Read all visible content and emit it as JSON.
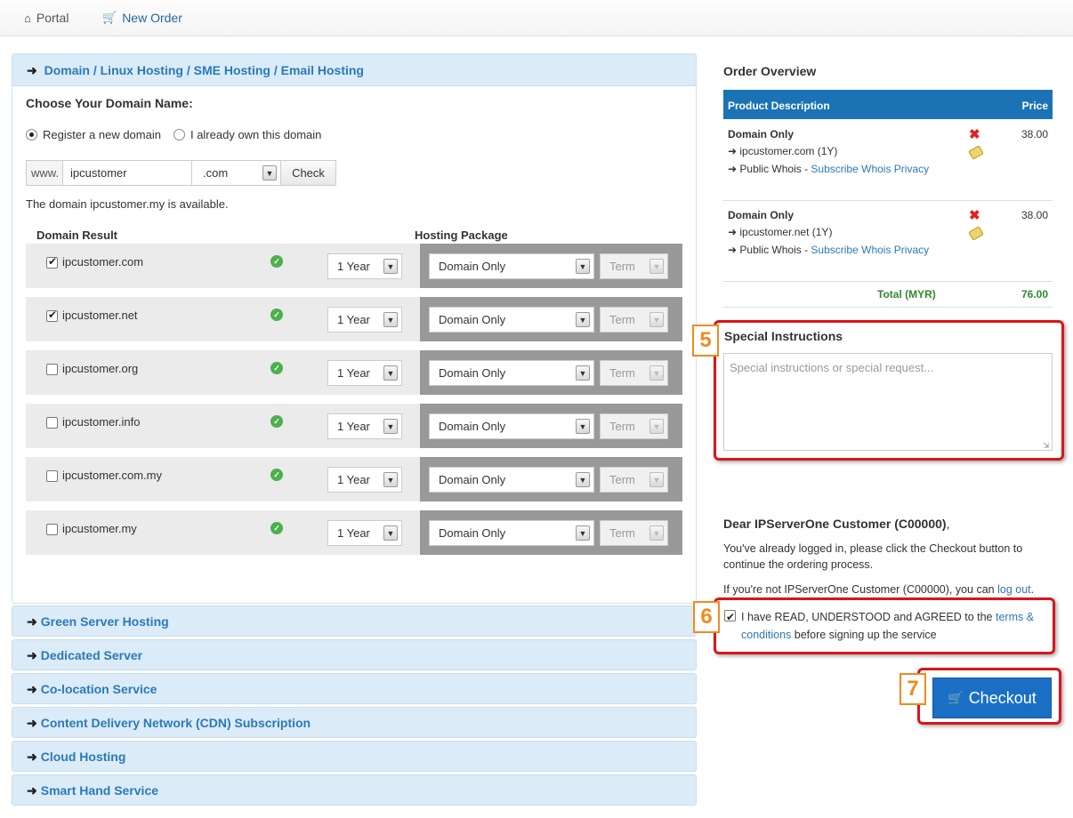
{
  "nav": {
    "portal": "Portal",
    "new_order": "New Order"
  },
  "panel": {
    "title": "Domain / Linux Hosting / SME Hosting / Email Hosting",
    "choose_label": "Choose Your Domain Name:",
    "radio_register": "Register a new domain",
    "radio_own": "I already own this domain",
    "www_prefix": "www.",
    "domain_input": "ipcustomer",
    "tld_selected": ".com",
    "check_button": "Check",
    "availability": "The domain ipcustomer.my is available.",
    "col_domain_result": "Domain Result",
    "col_hosting_package": "Hosting Package"
  },
  "results": [
    {
      "name": "ipcustomer.com",
      "checked": true,
      "year": "1 Year",
      "package": "Domain Only",
      "term": "Term"
    },
    {
      "name": "ipcustomer.net",
      "checked": true,
      "year": "1 Year",
      "package": "Domain Only",
      "term": "Term"
    },
    {
      "name": "ipcustomer.org",
      "checked": false,
      "year": "1 Year",
      "package": "Domain Only",
      "term": "Term"
    },
    {
      "name": "ipcustomer.info",
      "checked": false,
      "year": "1 Year",
      "package": "Domain Only",
      "term": "Term"
    },
    {
      "name": "ipcustomer.com.my",
      "checked": false,
      "year": "1 Year",
      "package": "Domain Only",
      "term": "Term"
    },
    {
      "name": "ipcustomer.my",
      "checked": false,
      "year": "1 Year",
      "package": "Domain Only",
      "term": "Term"
    }
  ],
  "accordions": [
    "Green Server Hosting",
    "Dedicated Server",
    "Co-location Service",
    "Content Delivery Network (CDN) Subscription",
    "Cloud Hosting",
    "Smart Hand Service"
  ],
  "overview": {
    "title": "Order Overview",
    "col_product": "Product Description",
    "col_price": "Price",
    "items": [
      {
        "title": "Domain Only",
        "domain": "ipcustomer.com (1Y)",
        "whois": "Public Whois",
        "dash": " - ",
        "privacy": "Subscribe Whois Privacy",
        "price": "38.00"
      },
      {
        "title": "Domain Only",
        "domain": "ipcustomer.net (1Y)",
        "whois": "Public Whois",
        "dash": " - ",
        "privacy": "Subscribe Whois Privacy",
        "price": "38.00"
      }
    ],
    "total_label": "Total (MYR)",
    "total_value": "76.00"
  },
  "special": {
    "title": "Special Instructions",
    "placeholder": "Special instructions or special request..."
  },
  "customer": {
    "dear": "Dear IPServerOne Customer (C00000)",
    "comma": ",",
    "logged_in": "You've already logged in, please click the Checkout button to continue the ordering process.",
    "not_customer": "If you're not IPServerOne Customer (C00000), you can ",
    "logout": "log out",
    "period": "."
  },
  "agree": {
    "text_before": "I have READ, UNDERSTOOD and AGREED to the ",
    "terms_link": "terms & conditions",
    "text_after": " before signing up the service",
    "checked": true
  },
  "checkout_label": "Checkout",
  "badges": [
    "5",
    "6",
    "7"
  ],
  "colors": {
    "accent": "#2a7ab8",
    "header_blue": "#1b73b6",
    "checkout": "#1a6fc4",
    "highlight": "#d9151b",
    "badge": "#f08a1e",
    "total": "#2e8b2e"
  }
}
